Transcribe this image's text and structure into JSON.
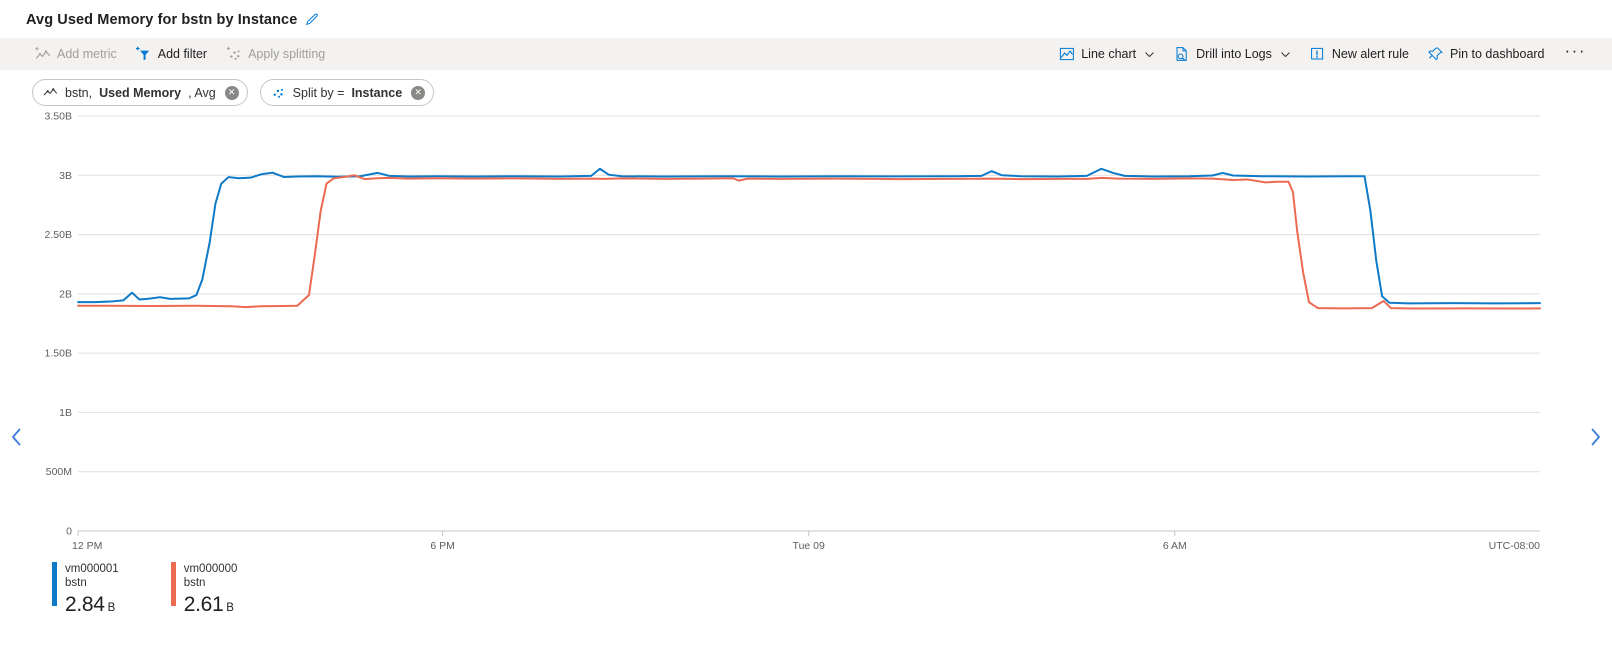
{
  "header": {
    "title": "Avg Used Memory for bstn by Instance",
    "edit_icon": "pencil-icon"
  },
  "toolbar": {
    "left": [
      {
        "label": "Add metric",
        "icon": "add-metric-icon",
        "disabled": true,
        "caret": false
      },
      {
        "label": "Add filter",
        "icon": "add-filter-icon",
        "disabled": false,
        "caret": false
      },
      {
        "label": "Apply splitting",
        "icon": "apply-splitting-icon",
        "disabled": true,
        "caret": false
      }
    ],
    "right": [
      {
        "label": "Line chart",
        "icon": "line-chart-icon",
        "disabled": false,
        "caret": true
      },
      {
        "label": "Drill into Logs",
        "icon": "drill-into-logs-icon",
        "disabled": false,
        "caret": true
      },
      {
        "label": "New alert rule",
        "icon": "new-alert-rule-icon",
        "disabled": false,
        "caret": false
      },
      {
        "label": "Pin to dashboard",
        "icon": "pin-icon",
        "disabled": false,
        "caret": false
      }
    ],
    "overflow_label": "···"
  },
  "chips": [
    {
      "icon": "metric-line-icon",
      "prefix": "bstn, ",
      "bold": "Used Memory",
      "suffix": ", Avg",
      "close_label": "✕"
    },
    {
      "icon": "split-scatter-icon",
      "prefix": "Split by = ",
      "bold": "Instance",
      "suffix": "",
      "close_label": "✕"
    }
  ],
  "nav": {
    "left_icon": "chevron-left-icon",
    "right_icon": "chevron-right-icon"
  },
  "timezone_label": "UTC-08:00",
  "legend": [
    {
      "name": "vm000001",
      "resource": "bstn",
      "value": "2.84",
      "unit": "B",
      "color": "#0f7ac8"
    },
    {
      "name": "vm000000",
      "resource": "bstn",
      "value": "2.61",
      "unit": "B",
      "color": "#ec6a51"
    }
  ],
  "chart_data": {
    "type": "line",
    "title": "Avg Used Memory for bstn by Instance",
    "xlabel": "",
    "ylabel": "",
    "grid": true,
    "legend_position": "bottom-left",
    "ylim": [
      0,
      3500000000
    ],
    "ytick_labels": [
      "3.50B",
      "3B",
      "2.50B",
      "2B",
      "1.50B",
      "1B",
      "500M",
      "0"
    ],
    "ytick_values": [
      3500000000,
      3000000000,
      2500000000,
      2000000000,
      1500000000,
      1000000000,
      500000000,
      0
    ],
    "xtick_labels": [
      "12 PM",
      "6 PM",
      "Tue 09",
      "6 AM"
    ],
    "xtick_fracs": [
      0.0,
      0.2494,
      0.4998,
      0.7502
    ],
    "series": [
      {
        "name": "vm000001",
        "resource": "bstn",
        "color": "#0f7ac8",
        "current": 2840000000,
        "points": [
          [
            0.0,
            1930000000
          ],
          [
            0.012,
            1930000000
          ],
          [
            0.022,
            1935000000
          ],
          [
            0.031,
            1945000000
          ],
          [
            0.037,
            2010000000
          ],
          [
            0.042,
            1952000000
          ],
          [
            0.049,
            1960000000
          ],
          [
            0.056,
            1972000000
          ],
          [
            0.063,
            1958000000
          ],
          [
            0.07,
            1960000000
          ],
          [
            0.076,
            1962000000
          ],
          [
            0.081,
            1990000000
          ],
          [
            0.085,
            2120000000
          ],
          [
            0.09,
            2430000000
          ],
          [
            0.094,
            2760000000
          ],
          [
            0.098,
            2930000000
          ],
          [
            0.103,
            2985000000
          ],
          [
            0.11,
            2975000000
          ],
          [
            0.118,
            2980000000
          ],
          [
            0.126,
            3010000000
          ],
          [
            0.133,
            3022000000
          ],
          [
            0.141,
            2985000000
          ],
          [
            0.15,
            2990000000
          ],
          [
            0.163,
            2992000000
          ],
          [
            0.178,
            2988000000
          ],
          [
            0.193,
            2992000000
          ],
          [
            0.205,
            3020000000
          ],
          [
            0.213,
            2995000000
          ],
          [
            0.226,
            2990000000
          ],
          [
            0.245,
            2992000000
          ],
          [
            0.27,
            2990000000
          ],
          [
            0.3,
            2992000000
          ],
          [
            0.33,
            2990000000
          ],
          [
            0.351,
            2995000000
          ],
          [
            0.357,
            3055000000
          ],
          [
            0.363,
            3005000000
          ],
          [
            0.372,
            2992000000
          ],
          [
            0.4,
            2990000000
          ],
          [
            0.44,
            2992000000
          ],
          [
            0.48,
            2990000000
          ],
          [
            0.52,
            2992000000
          ],
          [
            0.56,
            2991000000
          ],
          [
            0.6,
            2992000000
          ],
          [
            0.618,
            2995000000
          ],
          [
            0.625,
            3035000000
          ],
          [
            0.632,
            3000000000
          ],
          [
            0.645,
            2992000000
          ],
          [
            0.67,
            2990000000
          ],
          [
            0.69,
            2995000000
          ],
          [
            0.7,
            3055000000
          ],
          [
            0.708,
            3020000000
          ],
          [
            0.716,
            2995000000
          ],
          [
            0.735,
            2990000000
          ],
          [
            0.76,
            2992000000
          ],
          [
            0.776,
            2998000000
          ],
          [
            0.783,
            3020000000
          ],
          [
            0.79,
            2998000000
          ],
          [
            0.81,
            2992000000
          ],
          [
            0.84,
            2990000000
          ],
          [
            0.87,
            2992000000
          ],
          [
            0.88,
            2992000000
          ],
          [
            0.884,
            2700000000
          ],
          [
            0.888,
            2280000000
          ],
          [
            0.892,
            1980000000
          ],
          [
            0.897,
            1925000000
          ],
          [
            0.91,
            1920000000
          ],
          [
            0.94,
            1922000000
          ],
          [
            0.97,
            1920000000
          ],
          [
            1.0,
            1922000000
          ]
        ]
      },
      {
        "name": "vm000000",
        "resource": "bstn",
        "color": "#ec6a51",
        "current": 2610000000,
        "points": [
          [
            0.0,
            1900000000
          ],
          [
            0.02,
            1900000000
          ],
          [
            0.05,
            1898000000
          ],
          [
            0.08,
            1900000000
          ],
          [
            0.105,
            1896000000
          ],
          [
            0.115,
            1888000000
          ],
          [
            0.125,
            1896000000
          ],
          [
            0.14,
            1898000000
          ],
          [
            0.15,
            1900000000
          ],
          [
            0.158,
            1990000000
          ],
          [
            0.162,
            2330000000
          ],
          [
            0.166,
            2700000000
          ],
          [
            0.17,
            2930000000
          ],
          [
            0.175,
            2975000000
          ],
          [
            0.182,
            2985000000
          ],
          [
            0.189,
            3000000000
          ],
          [
            0.196,
            2968000000
          ],
          [
            0.205,
            2975000000
          ],
          [
            0.213,
            2978000000
          ],
          [
            0.226,
            2972000000
          ],
          [
            0.245,
            2975000000
          ],
          [
            0.27,
            2972000000
          ],
          [
            0.3,
            2974000000
          ],
          [
            0.33,
            2970000000
          ],
          [
            0.351,
            2972000000
          ],
          [
            0.36,
            2970000000
          ],
          [
            0.372,
            2974000000
          ],
          [
            0.4,
            2970000000
          ],
          [
            0.43,
            2972000000
          ],
          [
            0.448,
            2975000000
          ],
          [
            0.452,
            2955000000
          ],
          [
            0.458,
            2972000000
          ],
          [
            0.48,
            2970000000
          ],
          [
            0.52,
            2972000000
          ],
          [
            0.56,
            2968000000
          ],
          [
            0.6,
            2970000000
          ],
          [
            0.625,
            2972000000
          ],
          [
            0.645,
            2968000000
          ],
          [
            0.67,
            2970000000
          ],
          [
            0.69,
            2970000000
          ],
          [
            0.7,
            2978000000
          ],
          [
            0.712,
            2972000000
          ],
          [
            0.735,
            2970000000
          ],
          [
            0.76,
            2974000000
          ],
          [
            0.776,
            2972000000
          ],
          [
            0.79,
            2960000000
          ],
          [
            0.8,
            2965000000
          ],
          [
            0.812,
            2940000000
          ],
          [
            0.82,
            2945000000
          ],
          [
            0.828,
            2945000000
          ],
          [
            0.831,
            2860000000
          ],
          [
            0.834,
            2520000000
          ],
          [
            0.838,
            2180000000
          ],
          [
            0.842,
            1930000000
          ],
          [
            0.848,
            1880000000
          ],
          [
            0.865,
            1878000000
          ],
          [
            0.885,
            1880000000
          ],
          [
            0.893,
            1940000000
          ],
          [
            0.898,
            1880000000
          ],
          [
            0.915,
            1876000000
          ],
          [
            0.95,
            1878000000
          ],
          [
            0.98,
            1876000000
          ],
          [
            1.0,
            1878000000
          ]
        ]
      }
    ]
  }
}
